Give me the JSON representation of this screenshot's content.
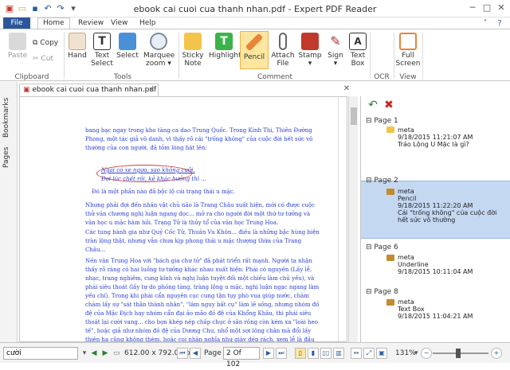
{
  "window": {
    "title": "ebook cai cuoi cua thanh nhan.pdf - Expert PDF Reader"
  },
  "quick_access": {
    "icons": [
      "app-icon",
      "open-icon",
      "save-icon",
      "undo-icon",
      "redo-icon",
      "customize-icon"
    ]
  },
  "ribbon_tabs": {
    "file": "File",
    "home": "Home",
    "review": "Review",
    "view": "View",
    "help": "Help"
  },
  "clipboard": {
    "paste": "Paste",
    "copy": "Copy",
    "cut": "Cut",
    "group": "Clipboard"
  },
  "tools": {
    "hand": "Hand",
    "text_select_1": "Text",
    "text_select_2": "Select",
    "select": "Select",
    "marquee_1": "Marquee",
    "marquee_2": "zoom",
    "group": "Tools"
  },
  "comment": {
    "sticky_1": "Sticky",
    "sticky_2": "Note",
    "highlight": "Highlight",
    "pencil": "Pencil",
    "attach_1": "Attach",
    "attach_2": "File",
    "stamp": "Stamp",
    "sign": "Sign",
    "textbox_1": "Text",
    "textbox_2": "Box",
    "group": "Comment"
  },
  "ocr": {
    "group": "OCR"
  },
  "view_group": {
    "full_1": "Full",
    "full_2": "Screen",
    "group": "View"
  },
  "side_tabs": {
    "bookmarks": "Bookmarks",
    "pages": "Pages"
  },
  "doc_tab": {
    "label": "ebook cai cuoi cua thanh nhan.pdf"
  },
  "document": {
    "p1": "bang bạc ngay trong kho tàng ca dao Trung Quốc. Trong Kinh Thi, Thiên Đường Phong, một tác giả vô danh, vì thấy rõ cái \"trống không\" của cuộc đời hết sức vô thường của con người, đã tỏm lòng hát lên:",
    "p2a": "Ngài có xe ngựa, sao không cưỡi,",
    "p2b": "Đợi lúc chết rồi, kẻ khác hưởng thì ...",
    "p3": "Đó là một phần nào đã bộc lộ cái trạng thái u mặc.",
    "p4": "Nhưng phải đợi đến nhân vật chủ não là Trang Châu xuất hiện, mới có được cuộc thử văn chương nghị luận ngang dọc... mở ra cho người đời một thứ tư tưởng và văn học u mặc hàm hồi. Trang Tử là thủy tổ của văn học Trung Hoa.",
    "p5": "Các tung hành gia như Quỷ Cốc Tử, Thuần Vu Khôn... điều là những bậc hùng biện tràn lộng thật, nhưng vẫn chưa kịp phong thái u mặc thượng thừa của Trang Châu...",
    "p6": "Nền văn Trung Hoa với \"bách gia chư tử\" đã phát triển rất mạnh. Người ta nhận thấy rõ ràng có hai luồng tư tưởng khác nhau xuất hiện: Phái có nguyên (Lấy lễ, nhạc, trang nghiêm, cung kính và nghị luận tuyệt đối một chiều làm chủ yếu), và phái siêu thoát (lấy tự do phóng tàng, tràng lộng u mặc, nghị luận ngạc ngang làm yếu chí). Trong khi phái cẩn nguyên cục cung tận tụy phò vua giúp nước, chăm chăm lấy sự \"sát thân thành nhân\", \"lâm nguy bất cụ\" làm lẽ sống, nhưng nhóm đồ đệ của Mặc Địch hay nhóm cẩn đại ảo mão đồ đệ của Khổng Khâu, thì phái siêu thoát lại cười vang... cho bọn khép nép chấp chục ở sân rồng còn kém xa \"loài heo tế\", hoặc giả như nhóm đồ đệ của Dương Chu, nhổ một sợi lông chân mà đổi lấy thiên hạ cũng không thèm, hoặc coi nhân nghĩa như giày dép rách, xem lễ là đầu mối của loạn ly triền"
  },
  "comments_panel": {
    "page1": "Page 1",
    "page1_author": "meta",
    "page1_date": "9/18/2015 11:21:07 AM",
    "page1_text": "Tráo Lộng U Mặc là gì?",
    "page2": "Page 2",
    "page2_author": "meta",
    "page2_type": "Pencil",
    "page2_date": "9/18/2015 11:22:20 AM",
    "page2_text1": "Cái \"trống không\" của cuộc đời",
    "page2_text2": "hết sức vô thường",
    "page6": "Page 6",
    "page6_author": "meta",
    "page6_type": "Underline",
    "page6_date": "9/18/2015 10:11:04 AM",
    "page8": "Page 8",
    "page8_author": "meta",
    "page8_type": "Text Box",
    "page8_date": "9/18/2015 11:04:21 AM"
  },
  "status": {
    "search_value": "cười",
    "page_size": "612.00 x 792.00 pt",
    "page_label": "Page",
    "page_value": "2 Of 102",
    "zoom": "131%"
  },
  "colors": {
    "file_tab": "#2b579a",
    "doc_text": "#2a3fd1",
    "selection": "#c5d8f2",
    "pencil_highlight": "#fde6a0",
    "annotation": "#d03a3a"
  }
}
